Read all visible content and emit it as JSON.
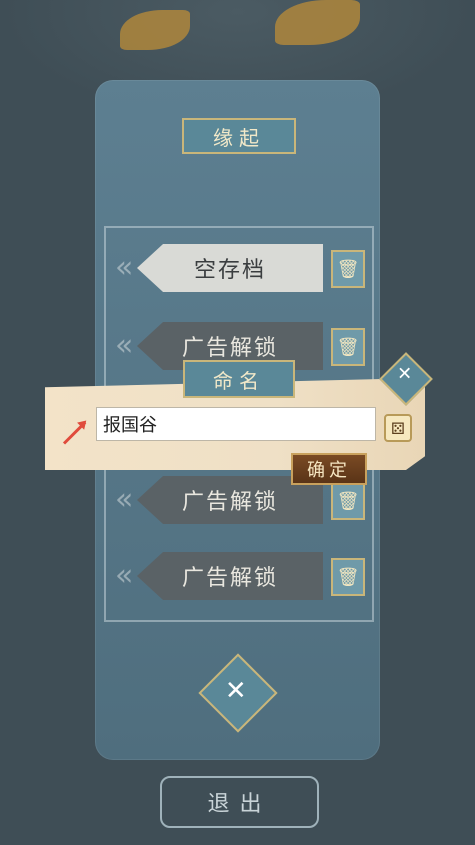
{
  "title": "缘起",
  "slots": [
    {
      "label": "空存档"
    },
    {
      "label": "广告解锁"
    },
    {
      "label": "广告解锁"
    },
    {
      "label": "广告解锁"
    }
  ],
  "dialog": {
    "title": "命名",
    "name_value": "报国谷",
    "confirm_label": "确定"
  },
  "exit_label": "退出",
  "icons": {
    "trash": "trash-icon",
    "bird": "bird-icon",
    "dice": "dice-icon"
  },
  "colors": {
    "panel": "#5d7f91",
    "accent": "#c9b67a"
  }
}
